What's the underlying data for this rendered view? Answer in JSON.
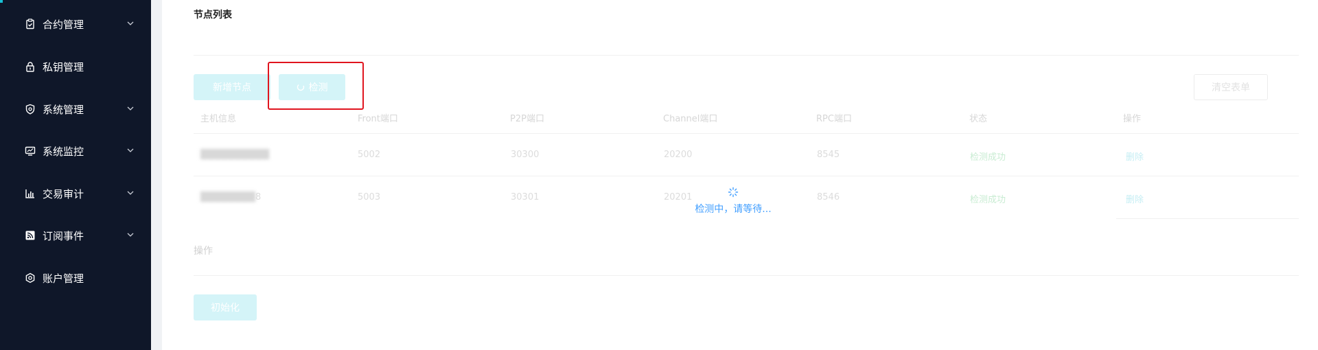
{
  "sidebar": {
    "items": [
      {
        "label": "合约管理",
        "icon": "clipboard-check-icon",
        "has_arrow": true
      },
      {
        "label": "私钥管理",
        "icon": "lock-icon",
        "has_arrow": false
      },
      {
        "label": "系统管理",
        "icon": "shield-icon",
        "has_arrow": true
      },
      {
        "label": "系统监控",
        "icon": "monitor-chart-icon",
        "has_arrow": true
      },
      {
        "label": "交易审计",
        "icon": "bar-chart-icon",
        "has_arrow": true
      },
      {
        "label": "订阅事件",
        "icon": "rss-icon",
        "has_arrow": true
      },
      {
        "label": "账户管理",
        "icon": "hexagon-user-icon",
        "has_arrow": false
      }
    ]
  },
  "node_list": {
    "title": "节点列表",
    "add_button": "新增节点",
    "check_button": "检测",
    "clear_button": "清空表单",
    "columns": [
      "主机信息",
      "Front端口",
      "P2P端口",
      "Channel端口",
      "RPC端口",
      "状态",
      "操作"
    ],
    "rows": [
      {
        "host_suffix": "",
        "front": "5002",
        "p2p": "30300",
        "channel": "20200",
        "rpc": "8545",
        "status": "检测成功",
        "action": "删除"
      },
      {
        "host_suffix": "8",
        "front": "5003",
        "p2p": "30301",
        "channel": "20201",
        "rpc": "8546",
        "status": "检测成功",
        "action": "删除"
      }
    ]
  },
  "operation": {
    "title": "操作",
    "init_button": "初始化"
  },
  "loading": {
    "text": "检测中，请等待..."
  },
  "colors": {
    "sidebar_bg": "#0f1729",
    "accent": "#19c1d6",
    "highlight": "#e0141e",
    "loading": "#409eff"
  }
}
